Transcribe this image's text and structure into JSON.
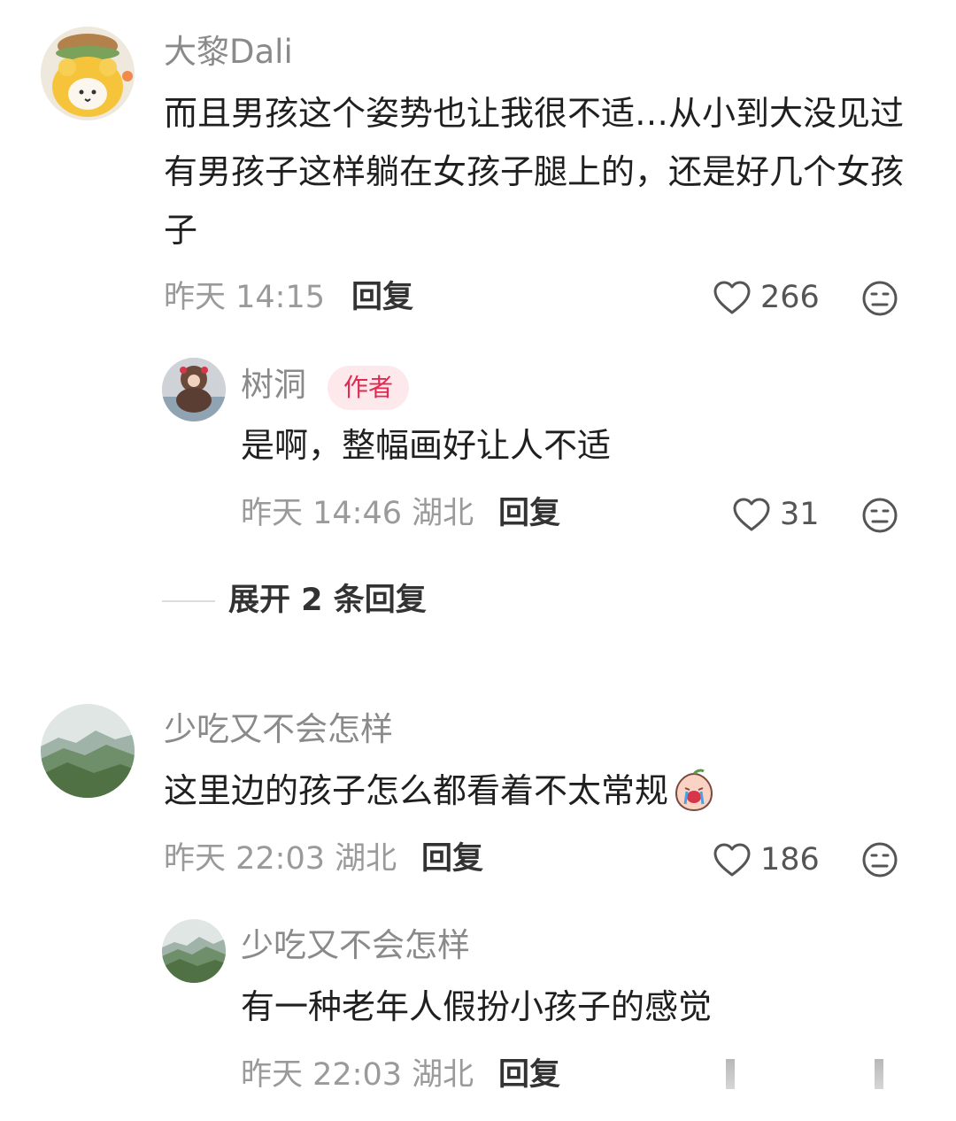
{
  "comments": [
    {
      "name": "大黎Dali",
      "text": "而且男孩这个姿势也让我很不适…从小到大没见过有男孩子这样躺在女孩子腿上的，还是好几个女孩子",
      "meta": "昨天 14:15",
      "reply_label": "回复",
      "likes": "266",
      "avatar_icon": "yellow-plush-avatar",
      "replies": [
        {
          "name": "树洞",
          "badge": "作者",
          "text": "是啊，整幅画好让人不适",
          "meta": "昨天 14:46 湖北",
          "reply_label": "回复",
          "likes": "31",
          "avatar_icon": "author-avatar"
        }
      ],
      "expand_label": "展开 2 条回复"
    },
    {
      "name": "少吃又不会怎样",
      "text": "这里边的孩子怎么都看着不太常规",
      "emoji": "crying-peach-emoji",
      "meta": "昨天 22:03 湖北",
      "reply_label": "回复",
      "likes": "186",
      "avatar_icon": "mountain-avatar",
      "replies": [
        {
          "name": "少吃又不会怎样",
          "text": "有一种老年人假扮小孩子的感觉",
          "meta": "昨天 22:03 湖北",
          "reply_label": "回复",
          "avatar_icon": "mountain-avatar"
        }
      ]
    }
  ],
  "colors": {
    "badge_bg": "#fde8ec",
    "badge_text": "#e02a52",
    "meta": "#9a9a9a",
    "name": "#8a8a8a"
  }
}
